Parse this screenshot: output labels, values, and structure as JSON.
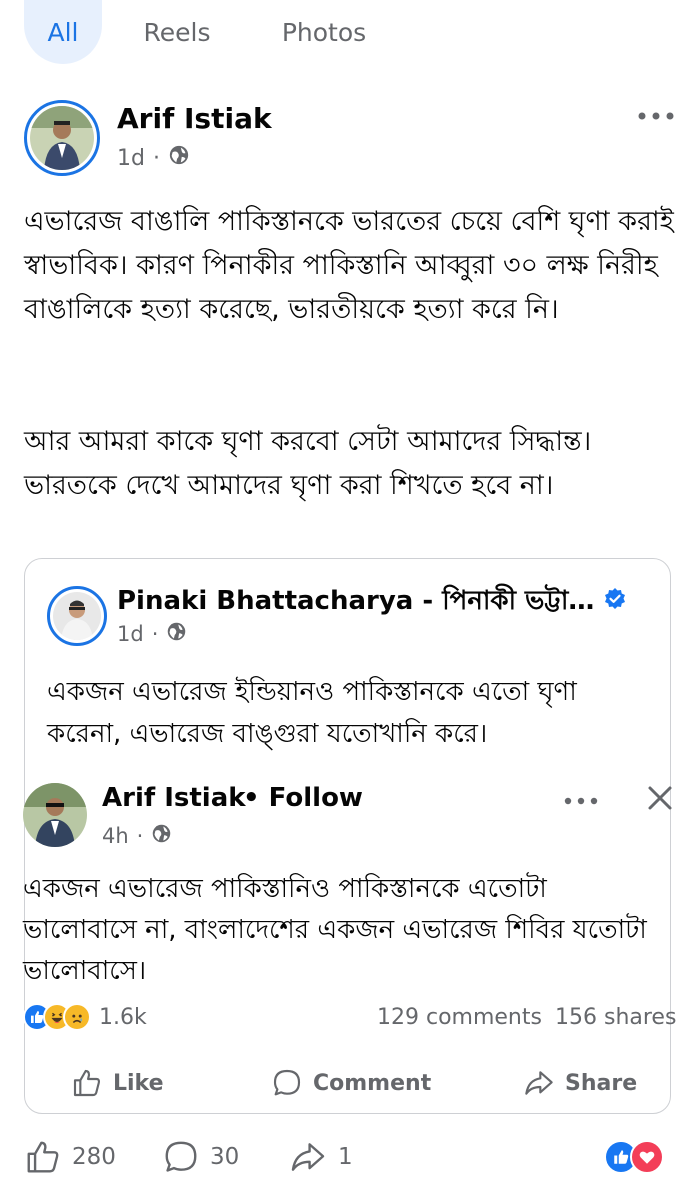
{
  "tabs": [
    {
      "label": "All",
      "active": true
    },
    {
      "label": "Reels",
      "active": false
    },
    {
      "label": "Photos",
      "active": false
    }
  ],
  "post": {
    "author": "Arif Istiak",
    "time": "1d",
    "separator": "·",
    "paragraphs": [
      "এভারেজ বাঙালি পাকিস্তানকে ভারতের চেয়ে বেশি ঘৃণা করাই স্বাভাবিক। কারণ পিনাকীর পাকিস্তানি আব্বুরা ৩০ লক্ষ নিরীহ বাঙালিকে হত্যা করেছে, ভারতীয়কে হত্যা করে নি।",
      "আর আমরা কাকে ঘৃণা করবো সেটা আমাদের সিদ্ধান্ত। ভারতকে দেখে আমাদের ঘৃণা করা শিখতে হবে না।"
    ]
  },
  "shared": {
    "author": "Pinaki Bhattacharya - পিনাকী ভট্টাচার্য",
    "time": "1d",
    "separator": "·",
    "text": "একজন এভারেজ ইন্ডিয়ানও পাকিস্তানকে এতো ঘৃণা করেনা, এভারেজ বাঙ্গুরা যতোখানি করে।"
  },
  "nested": {
    "author": "Arif Istiak",
    "follow": "• Follow",
    "time": "4h",
    "separator": "·",
    "text": "একজন এভারেজ পাকিস্তানিও পাকিস্তানকে এতোটা ভালোবাসে না, বাংলাদেশের একজন এভারেজ শিবির যতোটা ভালোবাসে।",
    "reaction_count": "1.6k",
    "comments": "129 comments",
    "shares": "156 shares",
    "actions": {
      "like": "Like",
      "comment": "Comment",
      "share": "Share"
    }
  },
  "bottom": {
    "likes": "280",
    "comments": "30",
    "shares": "1"
  },
  "colors": {
    "accent": "#1b74e4",
    "muted": "#65676b",
    "like_blue": "#1877f2",
    "love_red": "#f33e58",
    "haha_yellow": "#f7b928"
  },
  "icons": [
    "globe-icon",
    "more-icon",
    "verified-icon",
    "close-icon",
    "like-icon",
    "comment-icon",
    "share-icon"
  ]
}
